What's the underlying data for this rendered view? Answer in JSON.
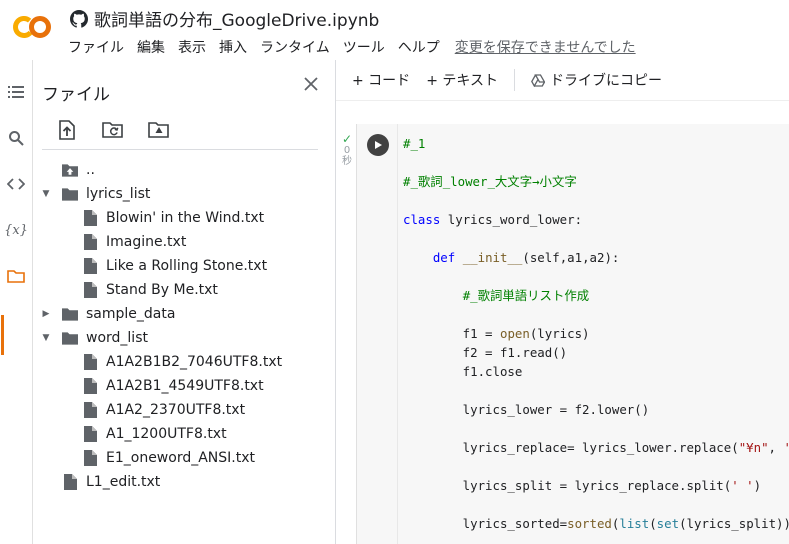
{
  "app": {
    "title": "歌詞単語の分布_GoogleDrive.ipynb",
    "menus": [
      "ファイル",
      "編集",
      "表示",
      "挿入",
      "ランタイム",
      "ツール",
      "ヘルプ"
    ],
    "unsaved_notice": "変更を保存できませんでした",
    "colors": {
      "accent": "#e8710a",
      "logo_orange": "#f9ab00",
      "logo_red": "#e8710a"
    }
  },
  "sidebar": {
    "rail_icons": [
      "list-icon",
      "search-icon",
      "code-icon",
      "variables-icon",
      "folder-icon"
    ],
    "variables_glyph": "{x}",
    "active_rail": "folder-icon"
  },
  "files_panel": {
    "title": "ファイル",
    "tools": [
      "upload-icon",
      "refresh-folder-icon",
      "drive-icon"
    ],
    "tree": [
      {
        "label": "..",
        "type": "folder-up",
        "level": 0
      },
      {
        "label": "lyrics_list",
        "type": "folder",
        "level": 0,
        "expanded": true
      },
      {
        "label": "Blowin' in the Wind.txt",
        "type": "file",
        "level": 1
      },
      {
        "label": "Imagine.txt",
        "type": "file",
        "level": 1
      },
      {
        "label": "Like a Rolling Stone.txt",
        "type": "file",
        "level": 1
      },
      {
        "label": "Stand By Me.txt",
        "type": "file",
        "level": 1
      },
      {
        "label": "sample_data",
        "type": "folder",
        "level": 0,
        "expanded": false
      },
      {
        "label": "word_list",
        "type": "folder",
        "level": 0,
        "expanded": true
      },
      {
        "label": "A1A2B1B2_7046UTF8.txt",
        "type": "file",
        "level": 1
      },
      {
        "label": "A1A2B1_4549UTF8.txt",
        "type": "file",
        "level": 1
      },
      {
        "label": "A1A2_2370UTF8.txt",
        "type": "file",
        "level": 1
      },
      {
        "label": "A1_1200UTF8.txt",
        "type": "file",
        "level": 1
      },
      {
        "label": "E1_oneword_ANSI.txt",
        "type": "file",
        "level": 1
      },
      {
        "label": "L1_edit.txt",
        "type": "file",
        "level": 0
      }
    ]
  },
  "notebook": {
    "toolbar": {
      "code_btn": "+ コード",
      "text_btn": "+ テキスト",
      "copy_drive_btn": "ドライブにコピー"
    },
    "cell_status": {
      "exec_time": "0",
      "exec_unit": "秒"
    },
    "code_lines": [
      [
        {
          "t": "#_1",
          "c": "cm"
        }
      ],
      [],
      [
        {
          "t": "#_歌詞_lower_大文字→小文字",
          "c": "cm"
        }
      ],
      [],
      [
        {
          "t": "class",
          "c": "kw"
        },
        {
          "t": " lyrics_word_lower:",
          "c": ""
        }
      ],
      [],
      [
        {
          "t": "    ",
          "c": ""
        },
        {
          "t": "def",
          "c": "kw"
        },
        {
          "t": " ",
          "c": ""
        },
        {
          "t": "__init__",
          "c": "fn"
        },
        {
          "t": "(self,a1,a2):",
          "c": ""
        }
      ],
      [],
      [
        {
          "t": "        ",
          "c": ""
        },
        {
          "t": "#_歌詞単語リスト作成",
          "c": "cm"
        }
      ],
      [],
      [
        {
          "t": "        f1 = ",
          "c": ""
        },
        {
          "t": "open",
          "c": "fn"
        },
        {
          "t": "(lyrics)",
          "c": ""
        }
      ],
      [
        {
          "t": "        f2 = f1.read()",
          "c": ""
        }
      ],
      [
        {
          "t": "        f1.close",
          "c": ""
        }
      ],
      [],
      [
        {
          "t": "        lyrics_lower = f2.lower()",
          "c": ""
        }
      ],
      [],
      [
        {
          "t": "        lyrics_replace= lyrics_lower.replace(",
          "c": ""
        },
        {
          "t": "\"¥n\"",
          "c": "st"
        },
        {
          "t": ", ",
          "c": ""
        },
        {
          "t": "' '",
          "c": "st"
        },
        {
          "t": ")",
          "c": ""
        }
      ],
      [],
      [
        {
          "t": "        lyrics_split = lyrics_replace.split(",
          "c": ""
        },
        {
          "t": "' '",
          "c": "st"
        },
        {
          "t": ")",
          "c": ""
        }
      ],
      [],
      [
        {
          "t": "        lyrics_sorted=",
          "c": ""
        },
        {
          "t": "sorted",
          "c": "fn"
        },
        {
          "t": "(",
          "c": ""
        },
        {
          "t": "list",
          "c": "bi"
        },
        {
          "t": "(",
          "c": ""
        },
        {
          "t": "set",
          "c": "bi"
        },
        {
          "t": "(lyrics_split)))",
          "c": ""
        }
      ]
    ]
  }
}
